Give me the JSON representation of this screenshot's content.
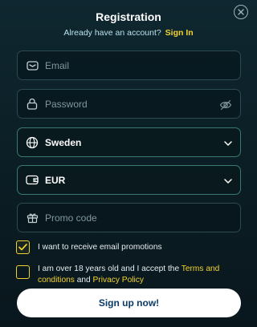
{
  "header": {
    "title": "Registration",
    "subtitle": "Already have an account?",
    "signin_label": "Sign In"
  },
  "close": {
    "icon": "close-icon"
  },
  "form": {
    "email": {
      "placeholder": "Email",
      "icon": "envelope-icon"
    },
    "password": {
      "placeholder": "Password",
      "icon": "lock-icon",
      "toggle_icon": "eye-off-icon"
    },
    "country": {
      "value": "Sweden",
      "icon": "globe-icon"
    },
    "currency": {
      "value": "EUR",
      "icon": "wallet-icon"
    },
    "promo": {
      "placeholder": "Promo code",
      "icon": "gift-icon"
    }
  },
  "checks": {
    "promotions": {
      "label": "I want to receive email promotions",
      "checked": true
    },
    "terms": {
      "before": "I am over 18 years old and I accept the ",
      "terms_link": "Terms and conditions",
      "and": " and ",
      "privacy_link": "Privacy Policy",
      "checked": false
    }
  },
  "signup_label": "Sign up now!",
  "colors": {
    "accent": "#f2d22e",
    "button_text": "#0b3b66",
    "field_border": "#2b4a52"
  }
}
